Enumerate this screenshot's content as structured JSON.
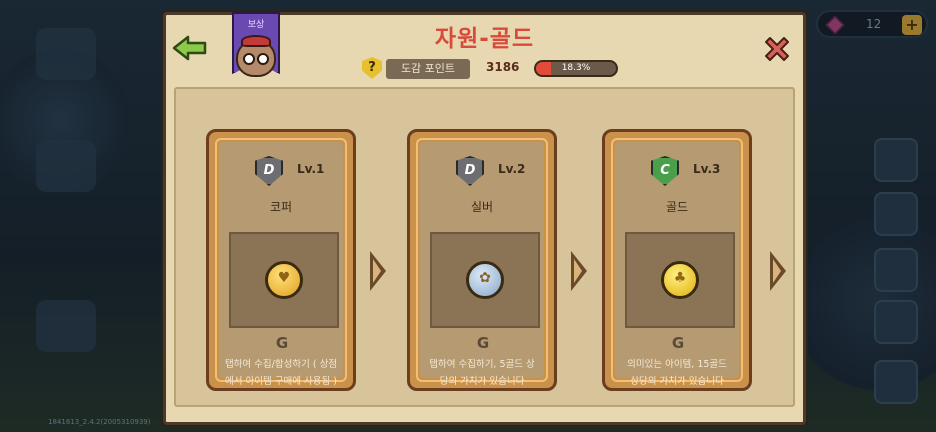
{
  "header": {
    "title": "자원-골드",
    "banner_label": "보상",
    "points_label": "도감 포인트",
    "points_value": "3186",
    "progress_text": "18.3%",
    "progress_fraction": 0.183
  },
  "hud": {
    "gem_count": "12",
    "plus": "+"
  },
  "version": "1841613_2.4.2(2005310939)",
  "colors": {
    "title": "#d84a3a",
    "panel": "#e8d8b2",
    "card": "#c9914a"
  },
  "cards": [
    {
      "grade": "D",
      "level": "Lv.1",
      "name": "코퍼",
      "coin": "copper",
      "mark": "G",
      "desc1": "탭하여 수집/합성하기 ( 상점",
      "desc2": "에서 아이템 구매에 사용됨 )"
    },
    {
      "grade": "D",
      "level": "Lv.2",
      "name": "실버",
      "coin": "silver",
      "mark": "G",
      "desc1": "탭하여 수집하기, 5골드 상",
      "desc2": "당의 가치가 있습니다"
    },
    {
      "grade": "C",
      "level": "Lv.3",
      "name": "골드",
      "coin": "gold",
      "mark": "G",
      "desc1": "의미있는 아이템, 15골드",
      "desc2": "상당의 가치가 있습니다"
    }
  ]
}
